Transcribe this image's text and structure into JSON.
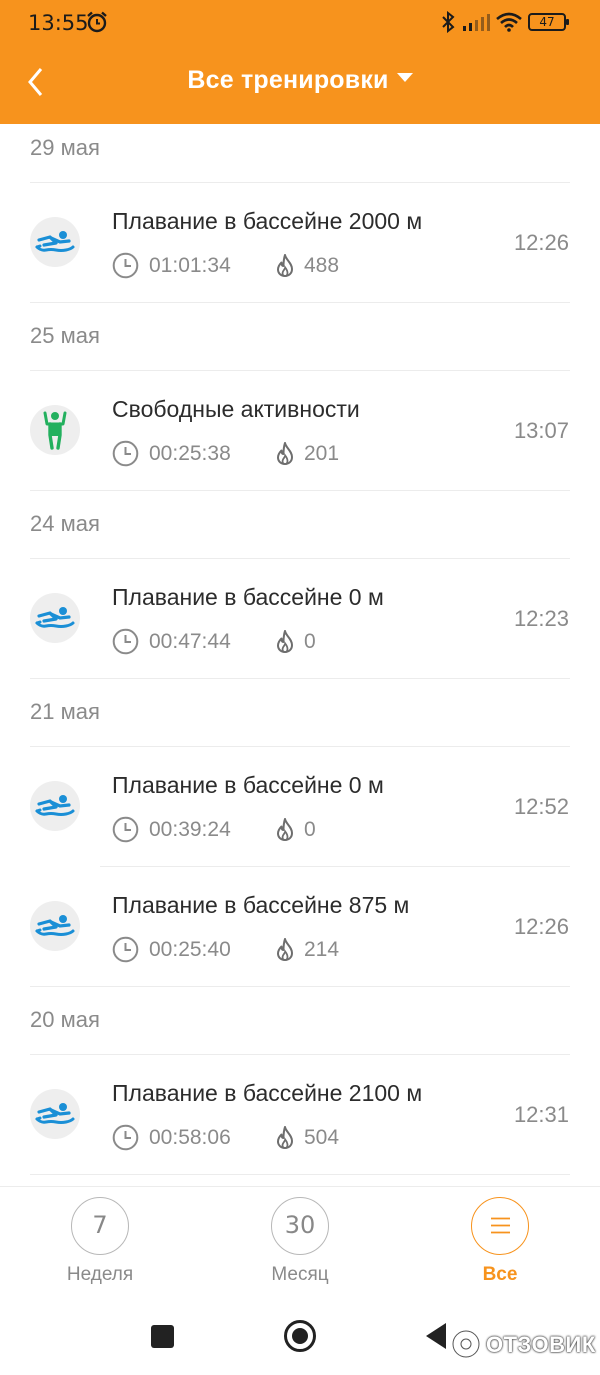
{
  "status_bar": {
    "time": "13:55",
    "battery": "47"
  },
  "header": {
    "title": "Все тренировки"
  },
  "groups": [
    {
      "date": "29 мая",
      "items": [
        {
          "type": "swim",
          "title": "Плавание в бассейне 2000 м",
          "duration": "01:01:34",
          "calories": "488",
          "time": "12:26"
        }
      ]
    },
    {
      "date": "25 мая",
      "items": [
        {
          "type": "free",
          "title": "Свободные активности",
          "duration": "00:25:38",
          "calories": "201",
          "time": "13:07"
        }
      ]
    },
    {
      "date": "24 мая",
      "items": [
        {
          "type": "swim",
          "title": "Плавание в бассейне 0 м",
          "duration": "00:47:44",
          "calories": "0",
          "time": "12:23"
        }
      ]
    },
    {
      "date": "21 мая",
      "items": [
        {
          "type": "swim",
          "title": "Плавание в бассейне 0 м",
          "duration": "00:39:24",
          "calories": "0",
          "time": "12:52"
        },
        {
          "type": "swim",
          "title": "Плавание в бассейне 875 м",
          "duration": "00:25:40",
          "calories": "214",
          "time": "12:26"
        }
      ]
    },
    {
      "date": "20 мая",
      "items": [
        {
          "type": "swim",
          "title": "Плавание в бассейне 2100 м",
          "duration": "00:58:06",
          "calories": "504",
          "time": "12:31"
        }
      ]
    }
  ],
  "tabs": [
    {
      "circle": "7",
      "label": "Неделя",
      "active": false
    },
    {
      "circle": "30",
      "label": "Месяц",
      "active": false
    },
    {
      "circle": "",
      "label": "Все",
      "active": true
    }
  ],
  "watermark": "ОТЗОВИК",
  "colors": {
    "accent": "#f7931d",
    "swim_icon": "#1a8fd6",
    "free_icon": "#23b05e"
  }
}
